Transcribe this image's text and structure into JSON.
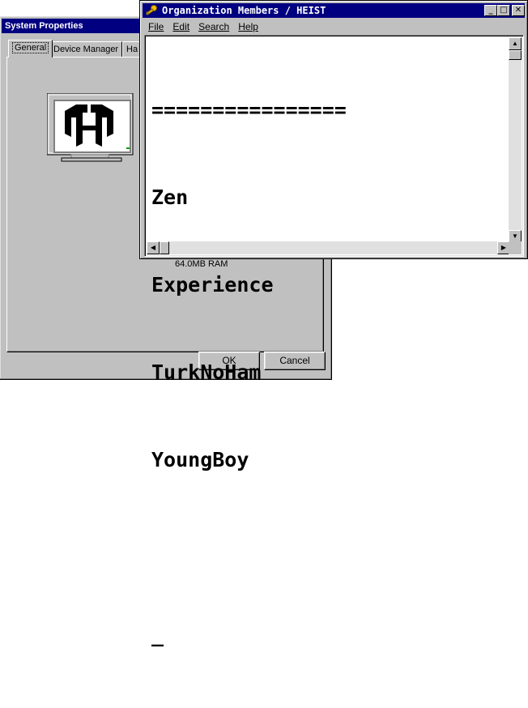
{
  "system_properties": {
    "title": "System Properties",
    "tabs": [
      "General",
      "Device Manager",
      "Ha"
    ],
    "ram": "64.0MB RAM",
    "buttons": {
      "ok": "OK",
      "cancel": "Cancel"
    }
  },
  "notepad": {
    "title": "Organization Members / HEIST",
    "menu": [
      "File",
      "Edit",
      "Search",
      "Help"
    ],
    "lines": [
      "================",
      "Zen",
      "Experience",
      "TurkNoHam",
      "YoungBoy",
      "",
      "_"
    ],
    "title_buttons": {
      "minimize": "_",
      "maximize": "□",
      "close": "✕"
    }
  },
  "colors": {
    "titlebar": "#000080",
    "face": "#c0c0c0"
  },
  "icons": [
    "key-icon",
    "monitor-icon",
    "heist-logo-icon",
    "scroll-up-arrow-icon",
    "scroll-down-arrow-icon",
    "scroll-left-arrow-icon",
    "scroll-right-arrow-icon"
  ]
}
